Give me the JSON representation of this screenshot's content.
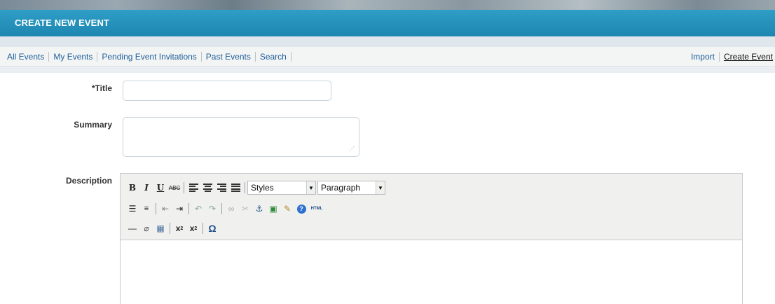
{
  "header": {
    "title": "CREATE NEW EVENT"
  },
  "nav": {
    "left": [
      "All Events",
      "My Events",
      "Pending Event Invitations",
      "Past Events",
      "Search"
    ],
    "import_label": "Import",
    "create_label": "Create Event"
  },
  "form": {
    "title_label": "*Title",
    "title_value": "",
    "summary_label": "Summary",
    "summary_value": "",
    "description_label": "Description"
  },
  "editor": {
    "styles_select": "Styles",
    "format_select": "Paragraph",
    "toolbar_row1": [
      "bold-icon",
      "italic-icon",
      "underline-icon",
      "strikethrough-icon",
      "align-left-icon",
      "align-center-icon",
      "align-right-icon",
      "align-justify-icon"
    ],
    "toolbar_row2": [
      "bullet-list-icon",
      "numbered-list-icon",
      "outdent-icon",
      "indent-icon",
      "undo-icon",
      "redo-icon",
      "link-icon",
      "unlink-icon",
      "anchor-icon",
      "image-icon",
      "cleanup-icon",
      "help-icon",
      "html-icon"
    ],
    "toolbar_row3": [
      "horizontal-rule-icon",
      "remove-format-icon",
      "table-icon",
      "subscript-icon",
      "superscript-icon",
      "special-char-icon"
    ],
    "content": ""
  },
  "colors": {
    "header_blue": "#2596c0",
    "link_blue": "#1f5f9a"
  }
}
